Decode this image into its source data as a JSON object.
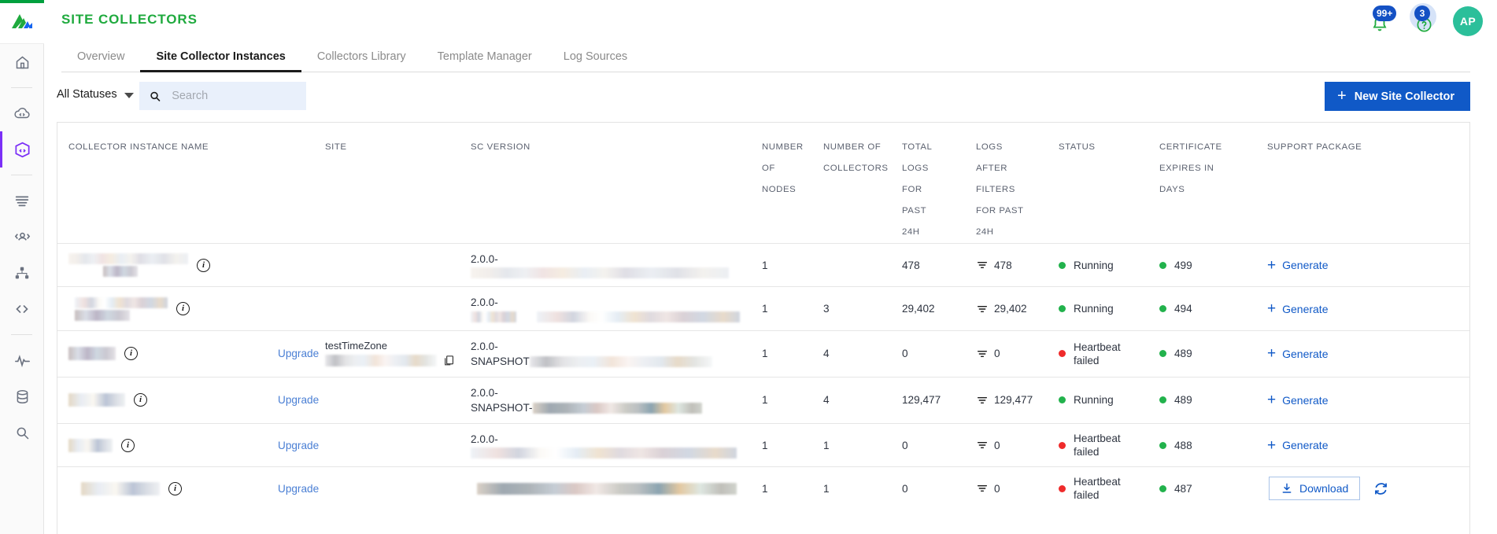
{
  "brand": {
    "accent_green": "#1faa3e",
    "accent_blue": "#1059c7",
    "accent_purple": "#7b2ff7"
  },
  "header": {
    "title": "SITE COLLECTORS",
    "notifications_badge": "99+",
    "help_badge": "3",
    "avatar_initials": "AP"
  },
  "rail": {
    "items": [
      {
        "icon": "home-icon",
        "active": false
      },
      {
        "icon": "cloud-code-icon",
        "active": false
      },
      {
        "icon": "cube-code-icon",
        "active": true
      },
      {
        "icon": "list-lines-icon",
        "active": false
      },
      {
        "icon": "users-icon",
        "active": false
      },
      {
        "icon": "hierarchy-icon",
        "active": false
      },
      {
        "icon": "code-brackets-icon",
        "active": false
      },
      {
        "icon": "activity-pulse-icon",
        "active": false
      },
      {
        "icon": "database-icon",
        "active": false
      },
      {
        "icon": "search-icon",
        "active": false
      }
    ]
  },
  "tabs": [
    {
      "label": "Overview",
      "active": false
    },
    {
      "label": "Site Collector Instances",
      "active": true
    },
    {
      "label": "Collectors Library",
      "active": false
    },
    {
      "label": "Template Manager",
      "active": false
    },
    {
      "label": "Log Sources",
      "active": false
    }
  ],
  "filterbar": {
    "status_filter_label": "All Statuses",
    "search_placeholder": "Search",
    "search_value": "",
    "new_button_label": "New Site Collector"
  },
  "table": {
    "columns": [
      "COLLECTOR INSTANCE NAME",
      "",
      "SITE",
      "SC VERSION",
      "NUMBER OF NODES",
      "NUMBER OF COLLECTORS",
      "TOTAL LOGS FOR PAST 24H",
      "LOGS AFTER FILTERS FOR PAST 24H",
      "STATUS",
      "CERTIFICATE EXPIRES IN DAYS",
      "SUPPORT PACKAGE"
    ],
    "column_lines": {
      "name": [
        "COLLECTOR INSTANCE NAME"
      ],
      "site": [
        "SITE"
      ],
      "version": [
        "SC VERSION"
      ],
      "nodes": [
        "NUMBER",
        "OF",
        "NODES"
      ],
      "collectors": [
        "NUMBER OF",
        "COLLECTORS"
      ],
      "total_logs": [
        "TOTAL",
        "LOGS",
        "FOR",
        "PAST",
        "24H"
      ],
      "after_filters": [
        "LOGS",
        "AFTER",
        "FILTERS",
        "FOR PAST",
        "24H"
      ],
      "status": [
        "STATUS"
      ],
      "certificate": [
        "CERTIFICATE",
        "EXPIRES IN",
        "DAYS"
      ],
      "support": [
        "SUPPORT PACKAGE"
      ]
    },
    "rows": [
      {
        "name_redacted": true,
        "upgrade": "",
        "site_label": "",
        "version_prefix": "2.0.0-",
        "version_suffix": "",
        "nodes": "1",
        "collectors": "",
        "total_logs": "478",
        "after_filters": "478",
        "status": "Running",
        "status_color": "green",
        "certificate_days": "499",
        "action": "Generate"
      },
      {
        "name_redacted": true,
        "upgrade": "",
        "site_label": "",
        "version_prefix": "2.0.0-",
        "version_suffix": "",
        "nodes": "1",
        "collectors": "3",
        "total_logs": "29,402",
        "after_filters": "29,402",
        "status": "Running",
        "status_color": "green",
        "certificate_days": "494",
        "action": "Generate"
      },
      {
        "name_redacted": true,
        "upgrade": "Upgrade",
        "site_label": "testTimeZone",
        "version_prefix": "2.0.0-",
        "version_suffix": "SNAPSHOT",
        "nodes": "1",
        "collectors": "4",
        "total_logs": "0",
        "after_filters": "0",
        "status": "Heartbeat failed",
        "status_color": "red",
        "certificate_days": "489",
        "action": "Generate"
      },
      {
        "name_redacted": true,
        "upgrade": "Upgrade",
        "site_label": "",
        "version_prefix": "2.0.0-",
        "version_suffix": "SNAPSHOT-",
        "nodes": "1",
        "collectors": "4",
        "total_logs": "129,477",
        "after_filters": "129,477",
        "status": "Running",
        "status_color": "green",
        "certificate_days": "489",
        "action": "Generate"
      },
      {
        "name_redacted": true,
        "upgrade": "Upgrade",
        "site_label": "",
        "version_prefix": "2.0.0-",
        "version_suffix": "",
        "nodes": "1",
        "collectors": "1",
        "total_logs": "0",
        "after_filters": "0",
        "status": "Heartbeat failed",
        "status_color": "red",
        "certificate_days": "488",
        "action": "Generate"
      },
      {
        "name_redacted": true,
        "upgrade": "Upgrade",
        "site_label": "",
        "version_prefix": "",
        "version_suffix": "",
        "nodes": "1",
        "collectors": "1",
        "total_logs": "0",
        "after_filters": "0",
        "status": "Heartbeat failed",
        "status_color": "red",
        "certificate_days": "487",
        "action": "Download"
      }
    ]
  }
}
